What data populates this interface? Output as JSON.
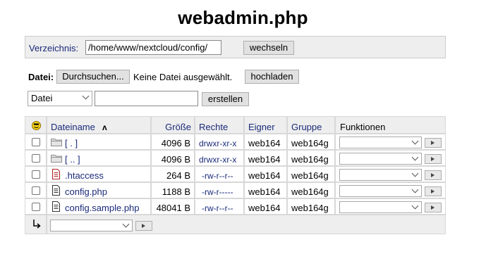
{
  "page_title": "webadmin.php",
  "directory": {
    "label": "Verzeichnis:",
    "path": "/home/www/nextcloud/config/",
    "change_button": "wechseln"
  },
  "upload": {
    "label": "Datei:",
    "browse_button": "Durchsuchen...",
    "no_file_text": "Keine Datei ausgewählt.",
    "upload_button": "hochladen"
  },
  "create": {
    "type_selected": "Datei",
    "name_value": "",
    "create_button": "erstellen"
  },
  "table": {
    "headers": {
      "select_icon": "smiley-icon",
      "name": "Dateiname",
      "sort_indicator": "ʌ",
      "size": "Größe",
      "rights": "Rechte",
      "owner": "Eigner",
      "group": "Gruppe",
      "functions": "Funktionen"
    },
    "rows": [
      {
        "icon": "folder-icon",
        "name": "[ . ]",
        "size": "4096 B",
        "rights": "drwxr-xr-x",
        "owner": "web164",
        "group": "web164g",
        "function": ""
      },
      {
        "icon": "folder-icon",
        "name": "[ .. ]",
        "size": "4096 B",
        "rights": "drwxr-xr-x",
        "owner": "web164",
        "group": "web164g",
        "function": ""
      },
      {
        "icon": "file-red-icon",
        "name": ".htaccess",
        "size": "264 B",
        "rights": "-rw-r--r--",
        "owner": "web164",
        "group": "web164g",
        "function": ""
      },
      {
        "icon": "file-icon",
        "name": "config.php",
        "size": "1188 B",
        "rights": "-rw-r-----",
        "owner": "web164",
        "group": "web164g",
        "function": ""
      },
      {
        "icon": "file-icon",
        "name": "config.sample.php",
        "size": "48041 B",
        "rights": "-rw-r--r--",
        "owner": "web164",
        "group": "web164g",
        "function": ""
      }
    ],
    "footer": {
      "arrow_icon": "return-arrow-icon",
      "bulk_action": ""
    }
  }
}
